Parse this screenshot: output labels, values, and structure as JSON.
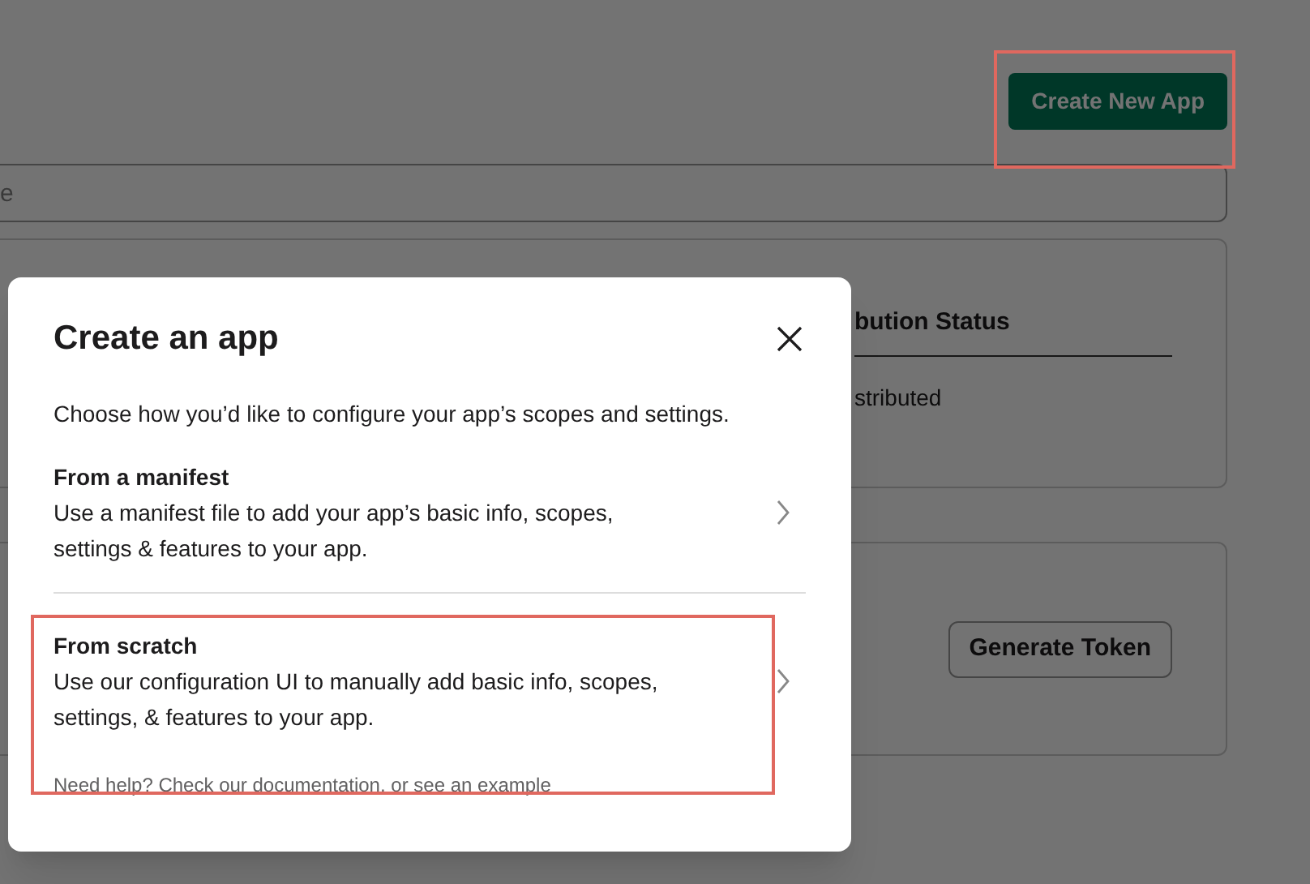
{
  "page": {
    "create_button": {
      "label": "Create New App",
      "highlighted": true
    },
    "search": {
      "placeholder": "e"
    },
    "apps_table": {
      "column_heading": "bution Status",
      "cell": "stributed"
    },
    "token_section": {
      "button": "Generate Token"
    }
  },
  "dialog": {
    "title": "Create an app",
    "description": "Choose how you’d like to configure your app’s scopes and settings.",
    "options": [
      {
        "title": "From a manifest",
        "description": "Use a manifest file to add your app’s basic info, scopes, settings & features to your app.",
        "highlighted": false
      },
      {
        "title": "From scratch",
        "description": "Use our configuration UI to manually add basic info, scopes, settings, & features to your app.",
        "highlighted": true
      }
    ],
    "help": {
      "prefix": "Need help? Check our ",
      "link_1": "documentation",
      "middle": ", or ",
      "link_2": "see an example"
    }
  }
}
